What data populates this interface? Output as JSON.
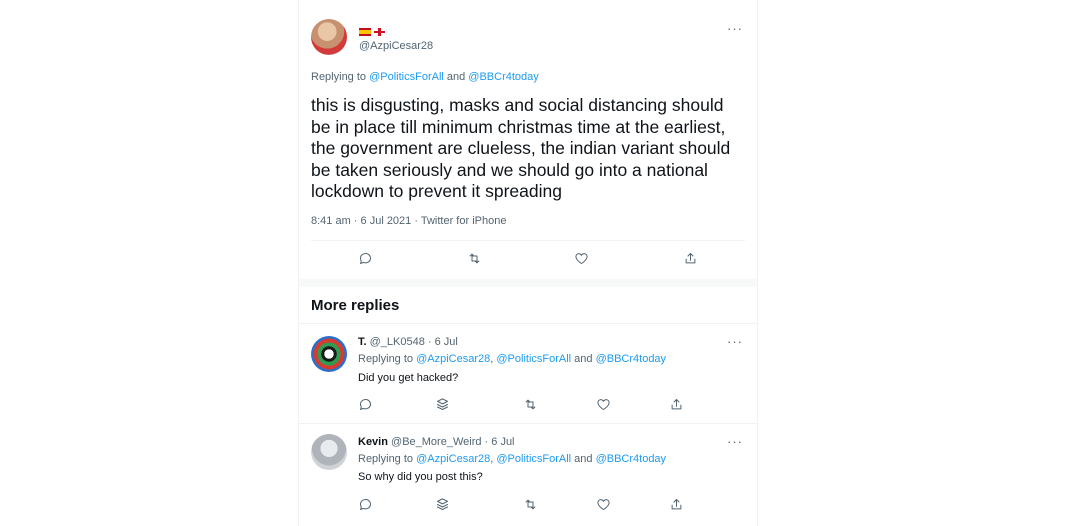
{
  "main_tweet": {
    "flags": "🇪🇸🏴",
    "handle": "@AzpiCesar28",
    "replying_prefix": "Replying to ",
    "replying_user1": "@PoliticsForAll",
    "replying_and": " and ",
    "replying_user2": "@BBCr4today",
    "text": "this is disgusting, masks and social distancing should be in place till minimum christmas time at the earliest, the government are clueless, the indian variant should be taken seriously and we should go into a national lockdown to prevent it spreading",
    "timestamp": "8:41 am · 6 Jul 2021 · Twitter for iPhone",
    "more": "···",
    "actions": [
      "reply-icon",
      "retweet-icon",
      "like-icon",
      "share-icon"
    ]
  },
  "more_replies_heading": "More replies",
  "replies": [
    {
      "name": "T.",
      "handle": "@_LK0548",
      "date": "· 6 Jul",
      "replying_prefix": "Replying to ",
      "replying_user1": "@AzpiCesar28",
      "replying_comma": ", ",
      "replying_user2": "@PoliticsForAll",
      "replying_and": " and ",
      "replying_user3": "@BBCr4today",
      "text": "Did you get hacked?",
      "more": "···"
    },
    {
      "name": "Kevin",
      "handle": "@Be_More_Weird",
      "date": "· 6 Jul",
      "replying_prefix": "Replying to ",
      "replying_user1": "@AzpiCesar28",
      "replying_comma": ", ",
      "replying_user2": "@PoliticsForAll",
      "replying_and": " and ",
      "replying_user3": "@BBCr4today",
      "text": "So why did you post this?",
      "more": "···"
    }
  ],
  "colors": {
    "link": "#1d9bf0",
    "secondary_text": "#536471",
    "primary_text": "#0f1419",
    "divider": "#eff3f4"
  }
}
